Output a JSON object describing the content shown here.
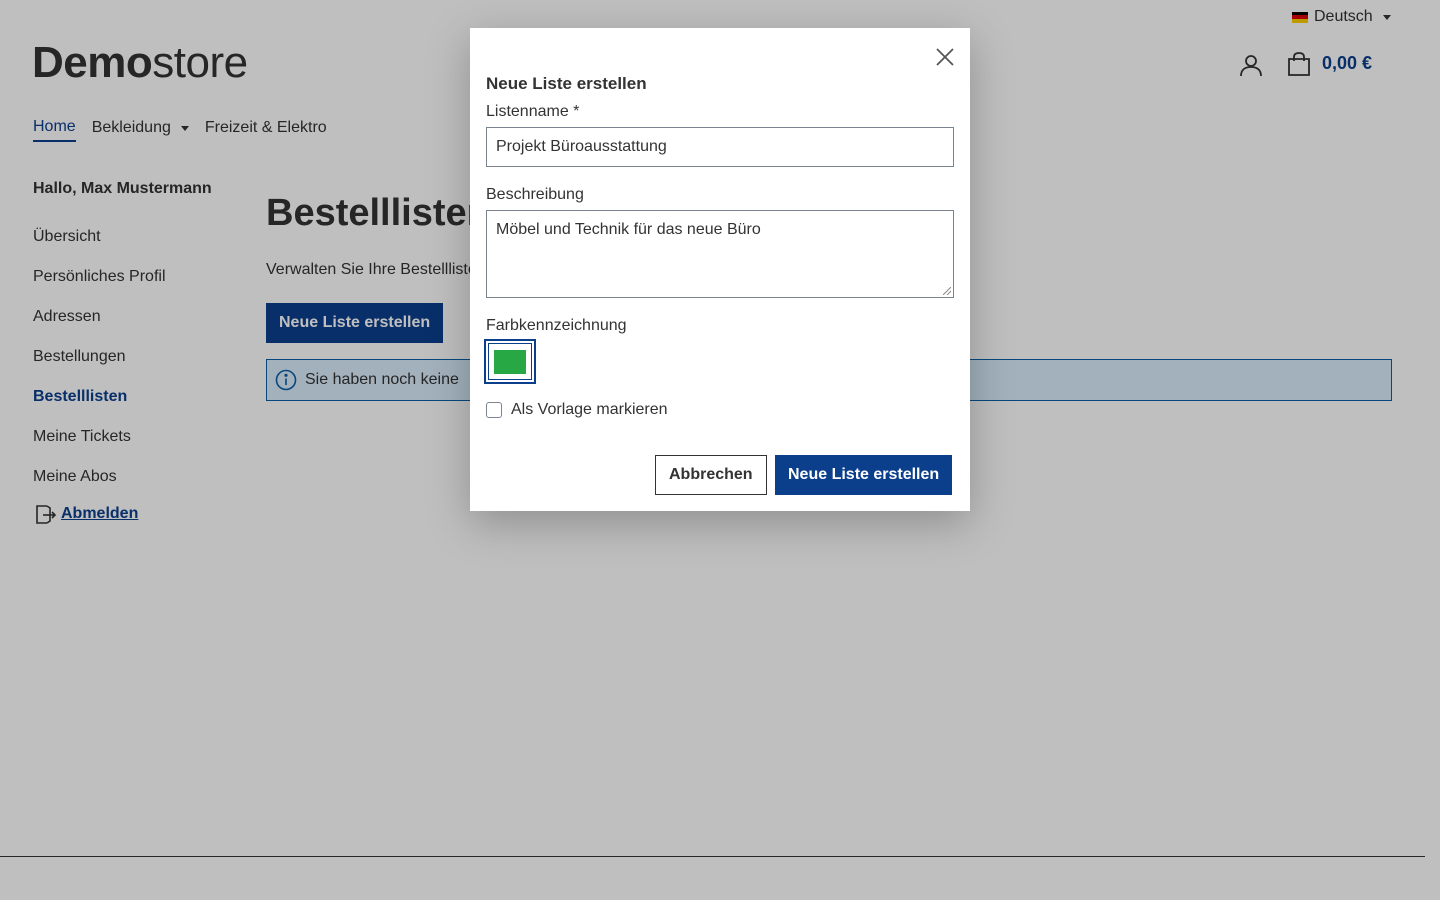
{
  "header": {
    "language": "Deutsch",
    "logo_bold": "Demo",
    "logo_light": "store",
    "cart_total": "0,00 €"
  },
  "nav": {
    "home": "Home",
    "clothing": "Bekleidung",
    "leisure": "Freizeit & Elektro"
  },
  "sidebar": {
    "greeting": "Hallo, Max Mustermann",
    "items": [
      {
        "label": "Übersicht"
      },
      {
        "label": "Persönliches Profil"
      },
      {
        "label": "Adressen"
      },
      {
        "label": "Bestellungen"
      },
      {
        "label": "Bestelllisten"
      },
      {
        "label": "Meine Tickets"
      },
      {
        "label": "Meine Abos"
      }
    ],
    "logout": "Abmelden"
  },
  "content": {
    "title": "Bestelllisten",
    "description": "Verwalten Sie Ihre Bestelllisten",
    "new_list_button": "Neue Liste erstellen",
    "alert_text": "Sie haben noch keine"
  },
  "modal": {
    "title": "Neue Liste erstellen",
    "name_label": "Listenname *",
    "name_value": "Projekt Büroausstattung",
    "description_label": "Beschreibung",
    "description_value": "Möbel und Technik für das neue Büro",
    "color_label": "Farbkennzeichnung",
    "selected_color": "#28a745",
    "template_checkbox_label": "Als Vorlage markieren",
    "template_checked": false,
    "cancel_button": "Abbrechen",
    "submit_button": "Neue Liste erstellen"
  },
  "colors": {
    "primary": "#0b3f8c",
    "alert_bg": "#d8ecfb",
    "overlay": "rgba(0,0,0,0.25)"
  }
}
